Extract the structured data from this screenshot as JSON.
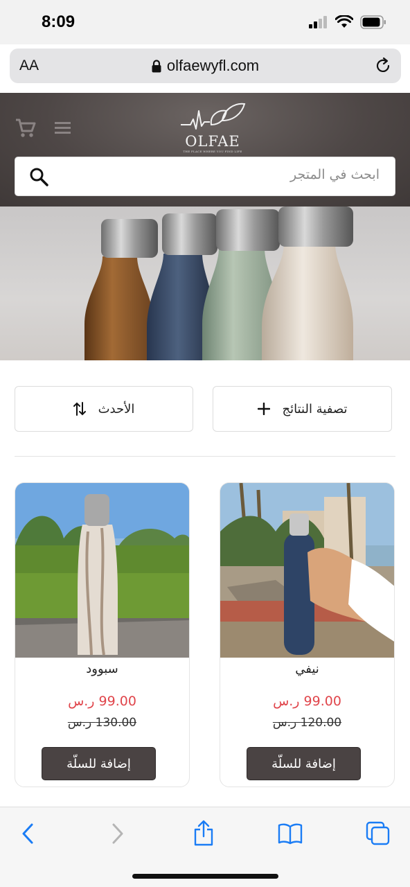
{
  "status_bar": {
    "time": "8:09"
  },
  "browser": {
    "text_size_label": "AA",
    "url": "olfaewyfl.com"
  },
  "store": {
    "logo_name": "OLFAE",
    "logo_tagline": "THE PLACE WHERE YOU FIND LIFE",
    "search_placeholder": "ابحث في المتجر"
  },
  "controls": {
    "sort_label": "الأحدث",
    "filter_label": "تصفية النتائج"
  },
  "products": [
    {
      "name": "نيفي",
      "price": "99.00 ر.س",
      "old_price": "120.00 ر.س",
      "button": "إضافة للسلّة"
    },
    {
      "name": "سبوود",
      "price": "99.00 ر.س",
      "old_price": "130.00 ر.س",
      "button": "إضافة للسلّة"
    }
  ],
  "colors": {
    "header_bg": "#4e4746",
    "price_red": "#e0454b",
    "button_bg": "#4a4343",
    "ios_blue": "#1a7cf5"
  },
  "icons": {
    "cart": "cart-icon",
    "menu": "menu-icon",
    "search": "search-icon",
    "sort": "sort-arrows-icon",
    "filter": "plus-icon",
    "back": "chevron-left-icon",
    "forward": "chevron-right-icon",
    "share": "share-icon",
    "bookmarks": "book-icon",
    "tabs": "tabs-icon"
  }
}
